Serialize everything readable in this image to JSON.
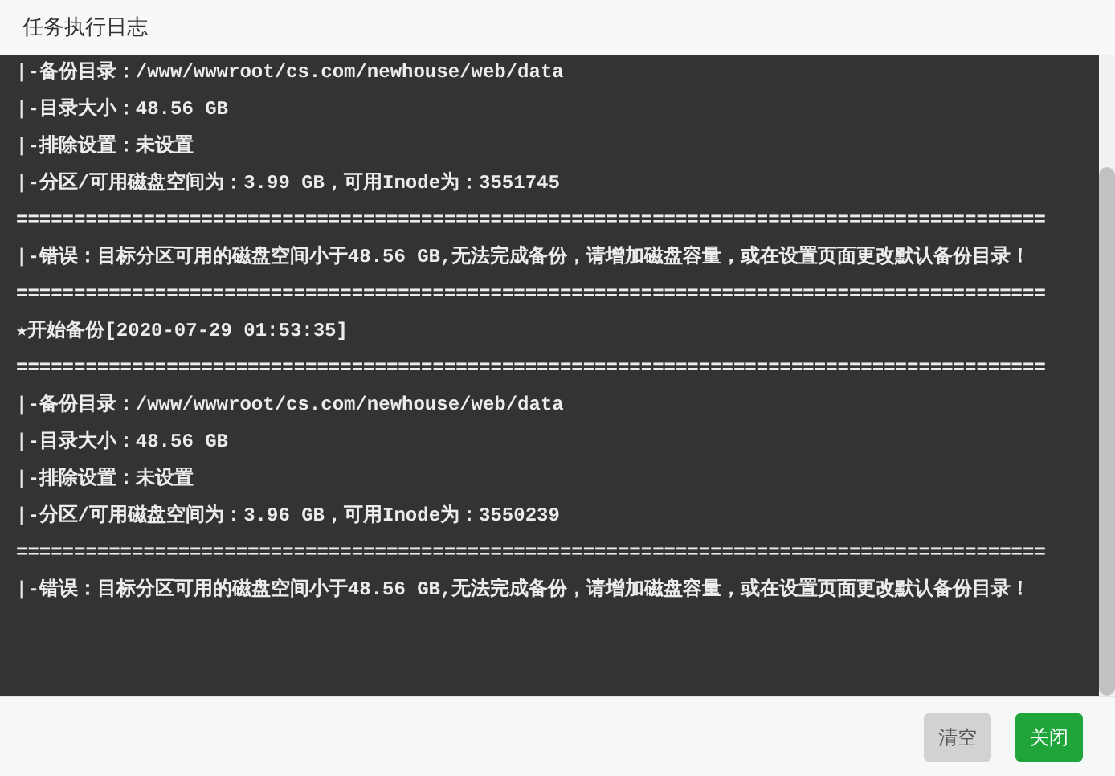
{
  "window": {
    "title": "任务执行日志"
  },
  "log_lines": [
    "|-备份目录：/www/wwwroot/cs.com/newhouse/web/data",
    "|-目录大小：48.56 GB",
    "|-排除设置：未设置",
    "|-分区/可用磁盘空间为：3.99 GB，可用Inode为：3551745",
    "=========================================================================================",
    "|-错误：目标分区可用的磁盘空间小于48.56 GB,无法完成备份，请增加磁盘容量，或在设置页面更改默认备份目录！",
    "=========================================================================================",
    "★开始备份[2020-07-29 01:53:35]",
    "=========================================================================================",
    "|-备份目录：/www/wwwroot/cs.com/newhouse/web/data",
    "|-目录大小：48.56 GB",
    "|-排除设置：未设置",
    "|-分区/可用磁盘空间为：3.96 GB，可用Inode为：3550239",
    "=========================================================================================",
    "|-错误：目标分区可用的磁盘空间小于48.56 GB,无法完成备份，请增加磁盘容量，或在设置页面更改默认备份目录！"
  ],
  "buttons": [
    {
      "label": "清空",
      "disabled": true
    },
    {
      "label": "关闭",
      "disabled": false
    }
  ]
}
